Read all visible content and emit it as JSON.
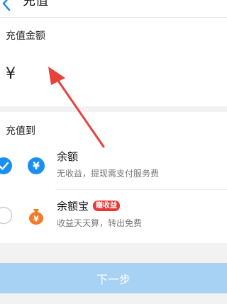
{
  "header": {
    "back_icon": "chevron-left-icon",
    "title": "充值"
  },
  "amount": {
    "label": "充值金额",
    "currency_symbol": "¥",
    "value": ""
  },
  "method": {
    "title": "充值到",
    "options": [
      {
        "name": "余额",
        "desc": "无收益，提现需支付服务费",
        "icon": "yen-coin-icon",
        "selected": true
      },
      {
        "name": "余额宝",
        "badge": "赚收益",
        "desc": "收益天天算，转出免费",
        "icon": "money-bag-icon",
        "selected": false
      }
    ]
  },
  "footer": {
    "next_label": "下一步"
  },
  "colors": {
    "accent": "#1a8ff2",
    "button_disabled": "#a7d2f4",
    "badge": "#e53935",
    "bag": "#f07c2b",
    "annotation_arrow": "#e8413a"
  }
}
